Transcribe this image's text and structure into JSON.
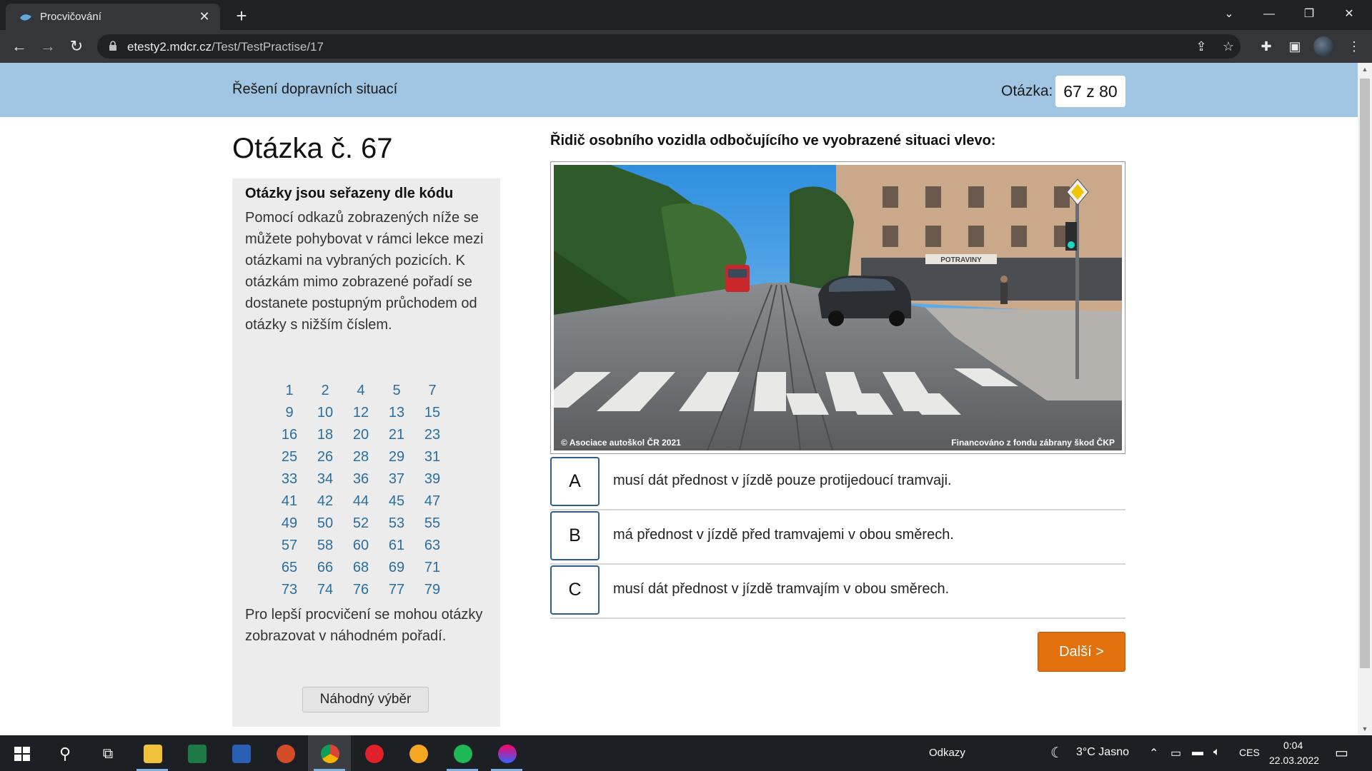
{
  "browser": {
    "tab_title": "Procvičování",
    "url_host": "etesty2.mdcr.cz",
    "url_path": "/Test/TestPractise/17"
  },
  "banner": {
    "section_title": "Řešení dopravních situací",
    "question_label": "Otázka:",
    "question_counter": "67 z 80"
  },
  "sidebar": {
    "heading": "Otázka č. 67",
    "sort_title": "Otázky jsou seřazeny dle kódu",
    "help_text": "Pomocí odkazů zobrazených níže se můžete pohybovat v rámci lekce mezi otázkami na vybraných pozicích. K otázkám mimo zobrazené pořadí se dostanete postupným průchodem od otázky s nižším číslem.",
    "question_numbers": [
      [
        "1",
        "2",
        "4",
        "5",
        "7"
      ],
      [
        "9",
        "10",
        "12",
        "13",
        "15"
      ],
      [
        "16",
        "18",
        "20",
        "21",
        "23"
      ],
      [
        "25",
        "26",
        "28",
        "29",
        "31"
      ],
      [
        "33",
        "34",
        "36",
        "37",
        "39"
      ],
      [
        "41",
        "42",
        "44",
        "45",
        "47"
      ],
      [
        "49",
        "50",
        "52",
        "53",
        "55"
      ],
      [
        "57",
        "58",
        "60",
        "61",
        "63"
      ],
      [
        "65",
        "66",
        "68",
        "69",
        "71"
      ],
      [
        "73",
        "74",
        "76",
        "77",
        "79"
      ]
    ],
    "random_text": "Pro lepší procvičení se mohou otázky zobrazovat v náhodném pořadí.",
    "random_button": "Náhodný výběr"
  },
  "question": {
    "text": "Řidič osobního vozidla odbočujícího ve vyobrazené situaci vlevo:",
    "photo_credit_left": "© Asociace autoškol ČR 2021",
    "photo_credit_right": "Financováno z fondu zábrany škod ČKP",
    "shop_sign": "POTRAVINY",
    "answers": [
      {
        "letter": "A",
        "text": "musí dát přednost v jízdě pouze protijedoucí tramvaji."
      },
      {
        "letter": "B",
        "text": "má přednost v jízdě před tramvajemi v obou směrech."
      },
      {
        "letter": "C",
        "text": "musí dát přednost v jízdě tramvajím v obou směrech."
      }
    ],
    "next_button": "Další >"
  },
  "taskbar": {
    "links_label": "Odkazy",
    "weather": "3°C  Jasno",
    "language": "CES",
    "time": "0:04",
    "date": "22.03.2022"
  }
}
